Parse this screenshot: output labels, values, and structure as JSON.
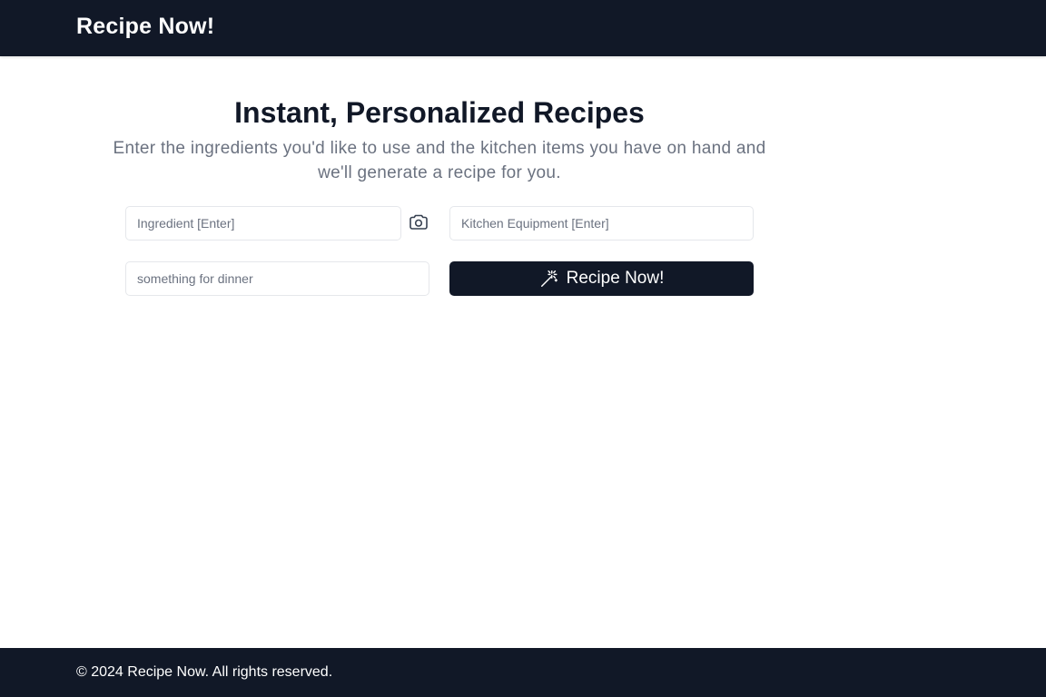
{
  "header": {
    "brand": "Recipe Now!"
  },
  "hero": {
    "title": "Instant, Personalized Recipes",
    "subtitle": "Enter the ingredients you'd like to use and the kitchen items you have on hand and we'll generate a recipe for you."
  },
  "form": {
    "ingredient": {
      "value": "",
      "placeholder": "Ingredient [Enter]"
    },
    "camera_icon": "camera-icon",
    "equipment": {
      "value": "",
      "placeholder": "Kitchen Equipment [Enter]"
    },
    "prompt": {
      "value": "",
      "placeholder": "something for dinner"
    },
    "submit": {
      "label": "Recipe Now!",
      "icon": "magic-wand-icon"
    }
  },
  "footer": {
    "text": "© 2024 Recipe Now. All rights reserved."
  },
  "colors": {
    "nav_bg": "#111827",
    "text_primary": "#111827",
    "text_muted": "#6b7280",
    "border": "#e5e7eb",
    "button_bg": "#111827"
  }
}
